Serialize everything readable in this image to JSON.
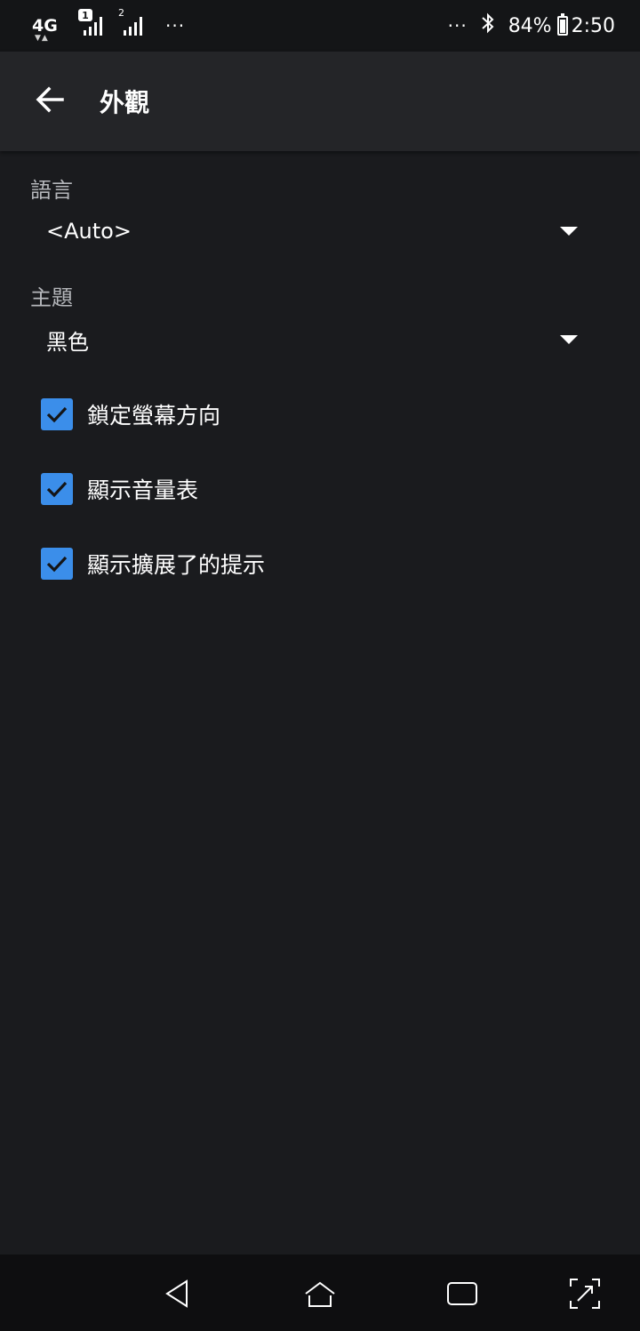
{
  "status_bar": {
    "network": "4G",
    "sim1_badge": "1",
    "sim2_badge": "2",
    "left_dots": "···",
    "right_dots": "···",
    "battery_percent": "84%",
    "time": "2:50"
  },
  "app_bar": {
    "title": "外觀"
  },
  "preferences": {
    "language": {
      "label": "語言",
      "value": "<Auto>"
    },
    "theme": {
      "label": "主題",
      "value": "黑色"
    },
    "checkboxes": [
      {
        "label": "鎖定螢幕方向",
        "checked": true
      },
      {
        "label": "顯示音量表",
        "checked": true
      },
      {
        "label": "顯示擴展了的提示",
        "checked": true
      }
    ]
  },
  "colors": {
    "background": "#1a1b1e",
    "app_bar": "#242528",
    "accent": "#3b8eea"
  },
  "icons": {
    "back": "arrow-left-icon",
    "dropdown": "caret-down-icon",
    "check": "check-icon",
    "nav_back": "triangle-back-icon",
    "nav_home": "home-icon",
    "nav_recents": "recents-icon",
    "nav_screenshot": "expand-icon"
  }
}
